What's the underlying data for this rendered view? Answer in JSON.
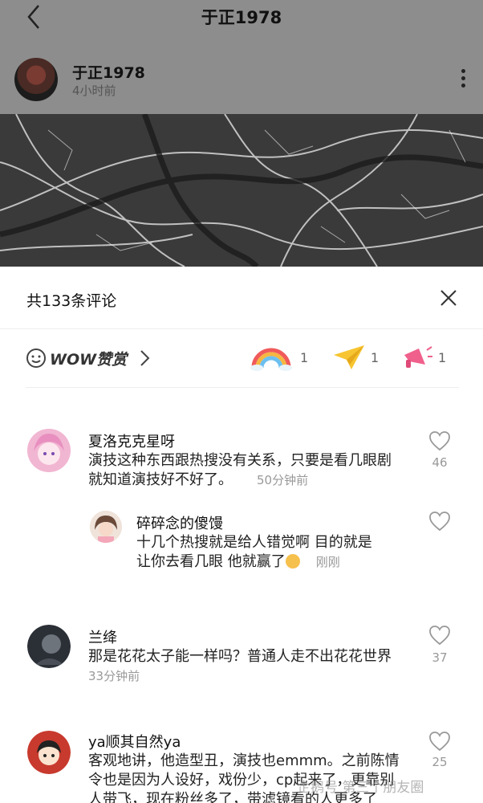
{
  "nav": {
    "title": "于正1978"
  },
  "author": {
    "name": "于正1978",
    "time": "4小时前"
  },
  "sheet": {
    "title": "共133条评论"
  },
  "wow": {
    "label": "WOW赞赏",
    "reactions": [
      {
        "name": "rainbow",
        "count": "1"
      },
      {
        "name": "paper-plane",
        "count": "1"
      },
      {
        "name": "megaphone",
        "count": "1"
      }
    ]
  },
  "comments": [
    {
      "name": "夏洛克克星呀",
      "line1": "演技这种东西跟热搜没有关系，只要是看几眼剧",
      "line2": "就知道演技好不好了。",
      "time": "50分钟前",
      "likes": "46"
    },
    {
      "name": "碎碎念的傻馒",
      "line1": "十几个热搜就是给人错觉啊 目的就是",
      "line2": "让你去看几眼 他就赢了",
      "time": "刚刚"
    },
    {
      "name": "兰绛",
      "line1": "那是花花太子能一样吗？普通人走不出花花世界",
      "time": "33分钟前",
      "likes": "37"
    },
    {
      "name": "ya顺其自然ya",
      "line1": "客观地讲，他造型丑，演技也emmm。之前陈情",
      "line2": "令也是因为人设好，戏份少，cp起来了，更靠别",
      "line3": "人带飞，现在粉丝多了，带滤镜看的人更多了",
      "likes": "25"
    }
  ],
  "watermark": "企鹅号 第三个朋友圈"
}
